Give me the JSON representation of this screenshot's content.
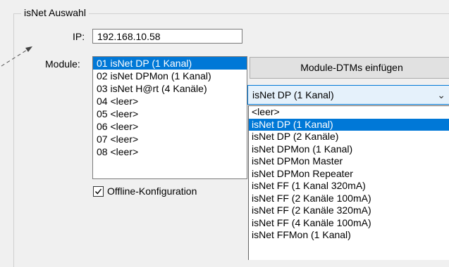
{
  "group": {
    "title": "isNet Auswahl"
  },
  "ip": {
    "label": "IP:",
    "value": "192.168.10.58"
  },
  "module": {
    "label": "Module:",
    "items": [
      "01 isNet DP (1 Kanal)",
      "02 isNet DPMon (1 Kanal)",
      "03 isNet H@rt (4 Kanäle)",
      "04 <leer>",
      "05 <leer>",
      "06 <leer>",
      "07 <leer>",
      "08 <leer>"
    ],
    "selected_index": 0
  },
  "offline": {
    "label": "Offline-Konfiguration",
    "checked": true
  },
  "insert_button": {
    "label": "Module-DTMs einfügen"
  },
  "combo": {
    "value": "isNet DP (1 Kanal)",
    "options": [
      "<leer>",
      "isNet DP (1 Kanal)",
      "isNet DP (2 Kanäle)",
      "isNet DPMon (1 Kanal)",
      "isNet DPMon Master",
      "isNet DPMon Repeater",
      "isNet FF (1 Kanal 320mA)",
      "isNet FF (2 Kanäle 100mA)",
      "isNet FF (2 Kanäle 320mA)",
      "isNet FF (4 Kanäle 100mA)",
      "isNet FFMon (1 Kanal)"
    ],
    "highlighted_index": 1
  },
  "colors": {
    "selection": "#0078d7",
    "combo_bg": "#e5f1fb"
  }
}
